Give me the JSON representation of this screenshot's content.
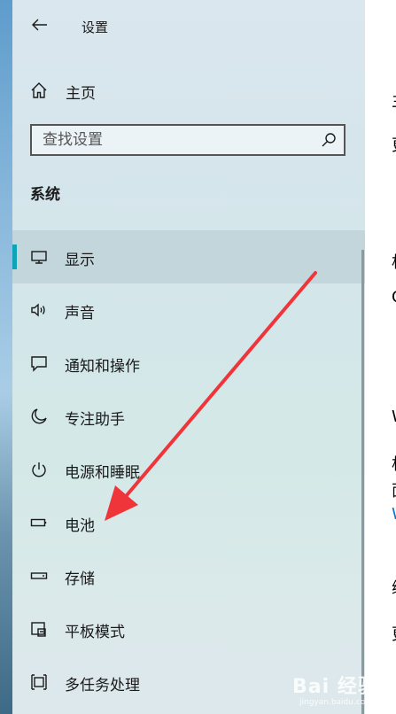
{
  "window": {
    "title": "设置"
  },
  "nav": {
    "home_label": "主页",
    "search_placeholder": "查找设置",
    "section_title": "系统",
    "items": [
      {
        "label": "显示",
        "icon": "monitor-icon",
        "selected": true
      },
      {
        "label": "声音",
        "icon": "speaker-icon",
        "selected": false
      },
      {
        "label": "通知和操作",
        "icon": "notification-icon",
        "selected": false
      },
      {
        "label": "专注助手",
        "icon": "moon-icon",
        "selected": false
      },
      {
        "label": "电源和睡眠",
        "icon": "power-icon",
        "selected": false
      },
      {
        "label": "电池",
        "icon": "battery-icon",
        "selected": false
      },
      {
        "label": "存储",
        "icon": "storage-icon",
        "selected": false
      },
      {
        "label": "平板模式",
        "icon": "tablet-mode-icon",
        "selected": false
      },
      {
        "label": "多任务处理",
        "icon": "multitasking-icon",
        "selected": false
      }
    ]
  },
  "content_fragments": [
    "主",
    "更",
    "相",
    "C",
    "W",
    "相",
    "面",
    "W",
    "缩",
    "更"
  ],
  "colors": {
    "accent": "#0fa3b7",
    "annotation_arrow": "#f0353a",
    "link": "#0078d4"
  },
  "watermark": {
    "brand": "Bai 经验",
    "site": "jingyan.baidu.com"
  }
}
